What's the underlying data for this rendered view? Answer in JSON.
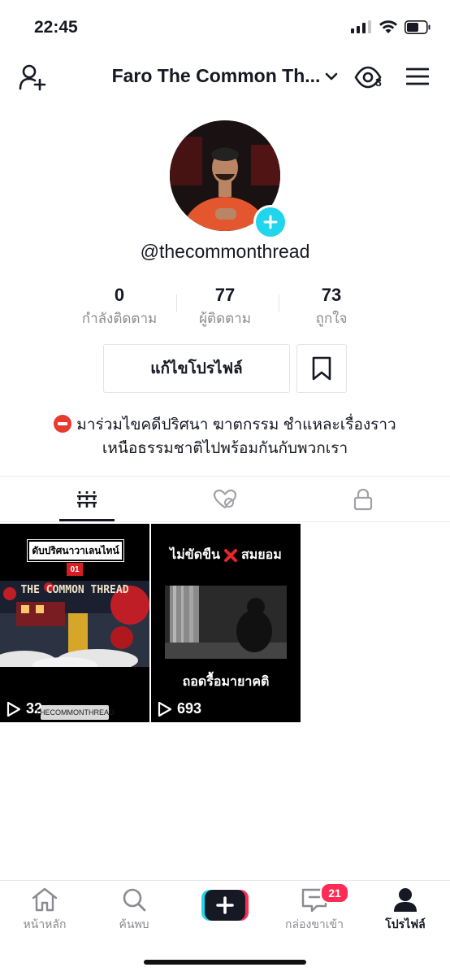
{
  "status_bar": {
    "time": "22:45"
  },
  "header": {
    "title": "Faro The Common Th...",
    "views_count": "3"
  },
  "profile": {
    "username": "@thecommonthread",
    "stats": [
      {
        "value": "0",
        "label": "กำลังติดตาม"
      },
      {
        "value": "77",
        "label": "ผู้ติดตาม"
      },
      {
        "value": "73",
        "label": "ถูกใจ"
      }
    ],
    "edit_button": "แก้ไขโปรไฟล์",
    "bio_line1": "มาร่วมไขคดีปริศนา ฆาตกรรม ชำแหละเรื่องราว",
    "bio_line2": "เหนือธรรมชาติไปพร้อมกันกับพวกเรา"
  },
  "videos": [
    {
      "title": "ดับปริศนาวาเลนไทน์",
      "episode": "01",
      "banner": "THE COMMON THREAD",
      "watermark": "THECOMMONTHREAD",
      "plays": "32"
    },
    {
      "title_left": "ไม่ขัดขืน",
      "title_right": "สมยอม",
      "caption": "ถอดรื้อมายาคติ",
      "plays": "693"
    }
  ],
  "bottom_nav": {
    "home": "หน้าหลัก",
    "discover": "ค้นพบ",
    "inbox": "กล่องขาเข้า",
    "inbox_badge": "21",
    "profile": "โปรไฟล์"
  }
}
